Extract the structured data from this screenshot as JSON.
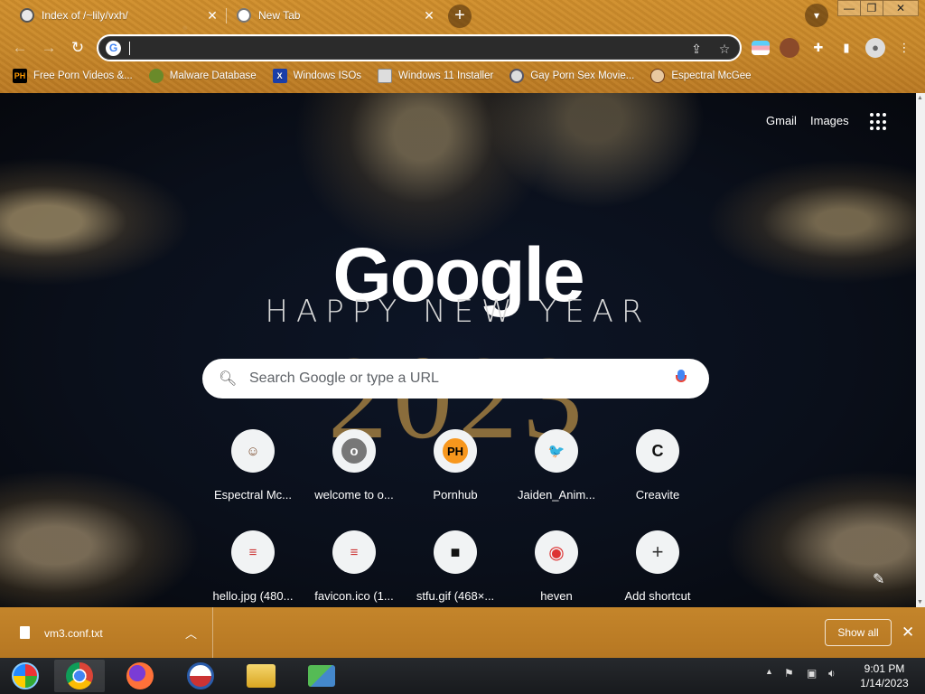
{
  "tabs": [
    {
      "title": "Index of /~lily/vxh/",
      "active": false
    },
    {
      "title": "New Tab",
      "active": true
    }
  ],
  "new_tab_button": "+",
  "window_controls": {
    "minimize": "—",
    "restore": "❐",
    "close": "✕"
  },
  "omnibox": {
    "value": "",
    "placeholder": ""
  },
  "bookmarks": [
    {
      "label": "Free Porn Videos &...",
      "icon": "PH"
    },
    {
      "label": "Malware Database",
      "icon": "leaf"
    },
    {
      "label": "Windows ISOs",
      "icon": "X"
    },
    {
      "label": "Windows 11 Installer",
      "icon": "installer"
    },
    {
      "label": "Gay Porn Sex Movie...",
      "icon": "gear"
    },
    {
      "label": "Espectral McGee",
      "icon": "avatar"
    }
  ],
  "ntp": {
    "links": {
      "gmail": "Gmail",
      "images": "Images"
    },
    "logo_text": "Google",
    "doodle_line": "HAPPY NEW YEAR",
    "doodle_year": "2023",
    "search_placeholder": "Search Google or type a URL",
    "shortcuts": [
      {
        "label": "Espectral Mc...",
        "icon_text": "☺"
      },
      {
        "label": "welcome to o...",
        "icon_text": "o"
      },
      {
        "label": "Pornhub",
        "icon_text": "PH"
      },
      {
        "label": "Jaiden_Anim...",
        "icon_text": "🐦"
      },
      {
        "label": "Creavite",
        "icon_text": "C"
      },
      {
        "label": "hello.jpg (480...",
        "icon_text": "≡"
      },
      {
        "label": "favicon.ico (1...",
        "icon_text": "≡"
      },
      {
        "label": "stfu.gif (468×...",
        "icon_text": "■"
      },
      {
        "label": "heven",
        "icon_text": "◉"
      },
      {
        "label": "Add shortcut",
        "icon_text": "+"
      }
    ]
  },
  "download_shelf": {
    "file_name": "vm3.conf.txt",
    "show_all": "Show all"
  },
  "taskbar": {
    "time": "9:01 PM",
    "date": "1/14/2023"
  },
  "colors": {
    "frame": "#c7882b",
    "ntp_bg": "#0a0f1a",
    "accent": "#4285f4"
  }
}
